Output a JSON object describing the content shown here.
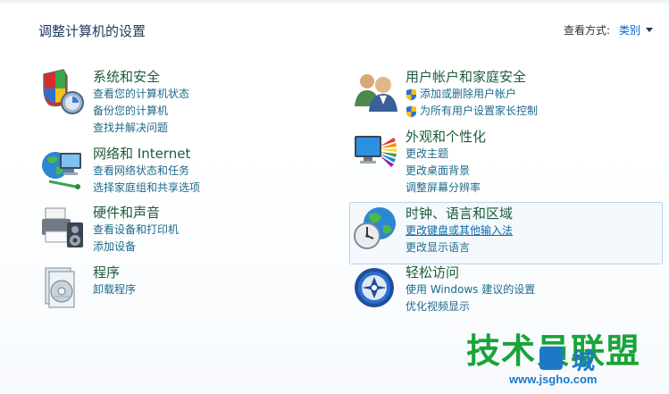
{
  "header": {
    "title": "调整计算机的设置",
    "view_by_label": "查看方式:",
    "view_by_value": "类别"
  },
  "categories": [
    {
      "heading": "系统和安全",
      "links": [
        "查看您的计算机状态",
        "备份您的计算机",
        "查找并解决问题"
      ]
    },
    {
      "heading": "网络和 Internet",
      "links": [
        "查看网络状态和任务",
        "选择家庭组和共享选项"
      ]
    },
    {
      "heading": "硬件和声音",
      "links": [
        "查看设备和打印机",
        "添加设备"
      ]
    },
    {
      "heading": "程序",
      "links": [
        "卸载程序"
      ]
    },
    {
      "heading": "用户帐户和家庭安全",
      "links": [
        "添加或删除用户帐户",
        "为所有用户设置家长控制"
      ]
    },
    {
      "heading": "外观和个性化",
      "links": [
        "更改主题",
        "更改桌面背景",
        "调整屏幕分辨率"
      ]
    },
    {
      "heading": "时钟、语言和区域",
      "links": [
        "更改键盘或其他输入法",
        "更改显示语言"
      ]
    },
    {
      "heading": "轻松访问",
      "links": [
        "使用 Windows 建议的设置",
        "优化视频显示"
      ]
    }
  ],
  "watermark": {
    "line1": "技术员联盟",
    "line2": "城",
    "line3": "www.jsgho.com"
  },
  "colors": {
    "heading": "#1e5b3a",
    "link": "#1e6a8a",
    "accent": "#0066cc"
  }
}
